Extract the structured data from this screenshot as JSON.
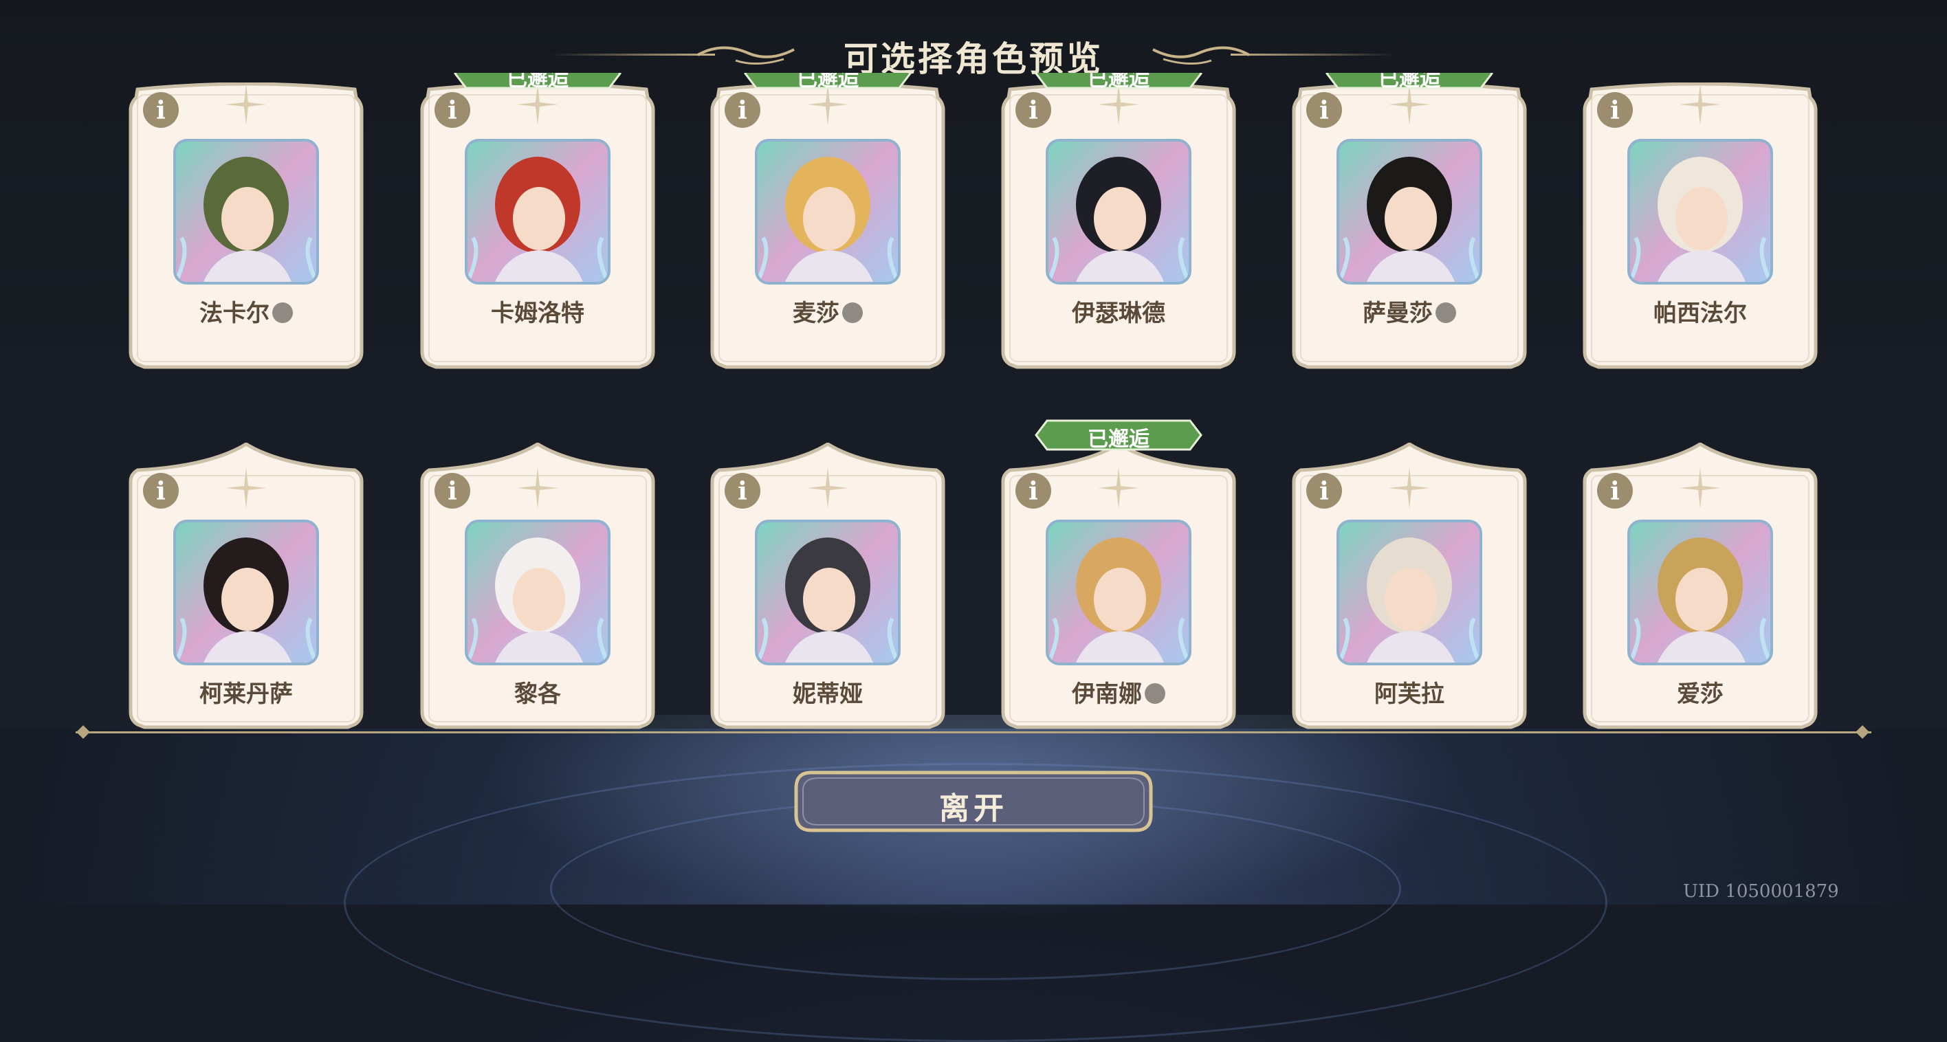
{
  "title": "可选择角色预览",
  "met_label": "已邂逅",
  "info_glyph": "i",
  "leave_button": "离开",
  "uid": "UID 1050001879",
  "colors": {
    "card_bg": "#fbf3ea",
    "card_border": "#cbbfa7",
    "met_green": "#5c9c4e",
    "button_bg": "#5c5f7a",
    "gold": "#c9b48a"
  },
  "row1": [
    {
      "name": "法卡尔",
      "met": false,
      "badge": true
    },
    {
      "name": "卡姆洛特",
      "met": true,
      "badge": false
    },
    {
      "name": "麦莎",
      "met": true,
      "badge": true
    },
    {
      "name": "伊瑟琳德",
      "met": true,
      "badge": false
    },
    {
      "name": "萨曼莎",
      "met": true,
      "badge": true
    },
    {
      "name": "帕西法尔",
      "met": false,
      "badge": false
    }
  ],
  "row2": [
    {
      "name": "柯莱丹萨",
      "met": false,
      "badge": false
    },
    {
      "name": "黎各",
      "met": false,
      "badge": false
    },
    {
      "name": "妮蒂娅",
      "met": false,
      "badge": false
    },
    {
      "name": "伊南娜",
      "met": true,
      "badge": true
    },
    {
      "name": "阿芙拉",
      "met": false,
      "badge": false
    },
    {
      "name": "爱莎",
      "met": false,
      "badge": false
    }
  ]
}
